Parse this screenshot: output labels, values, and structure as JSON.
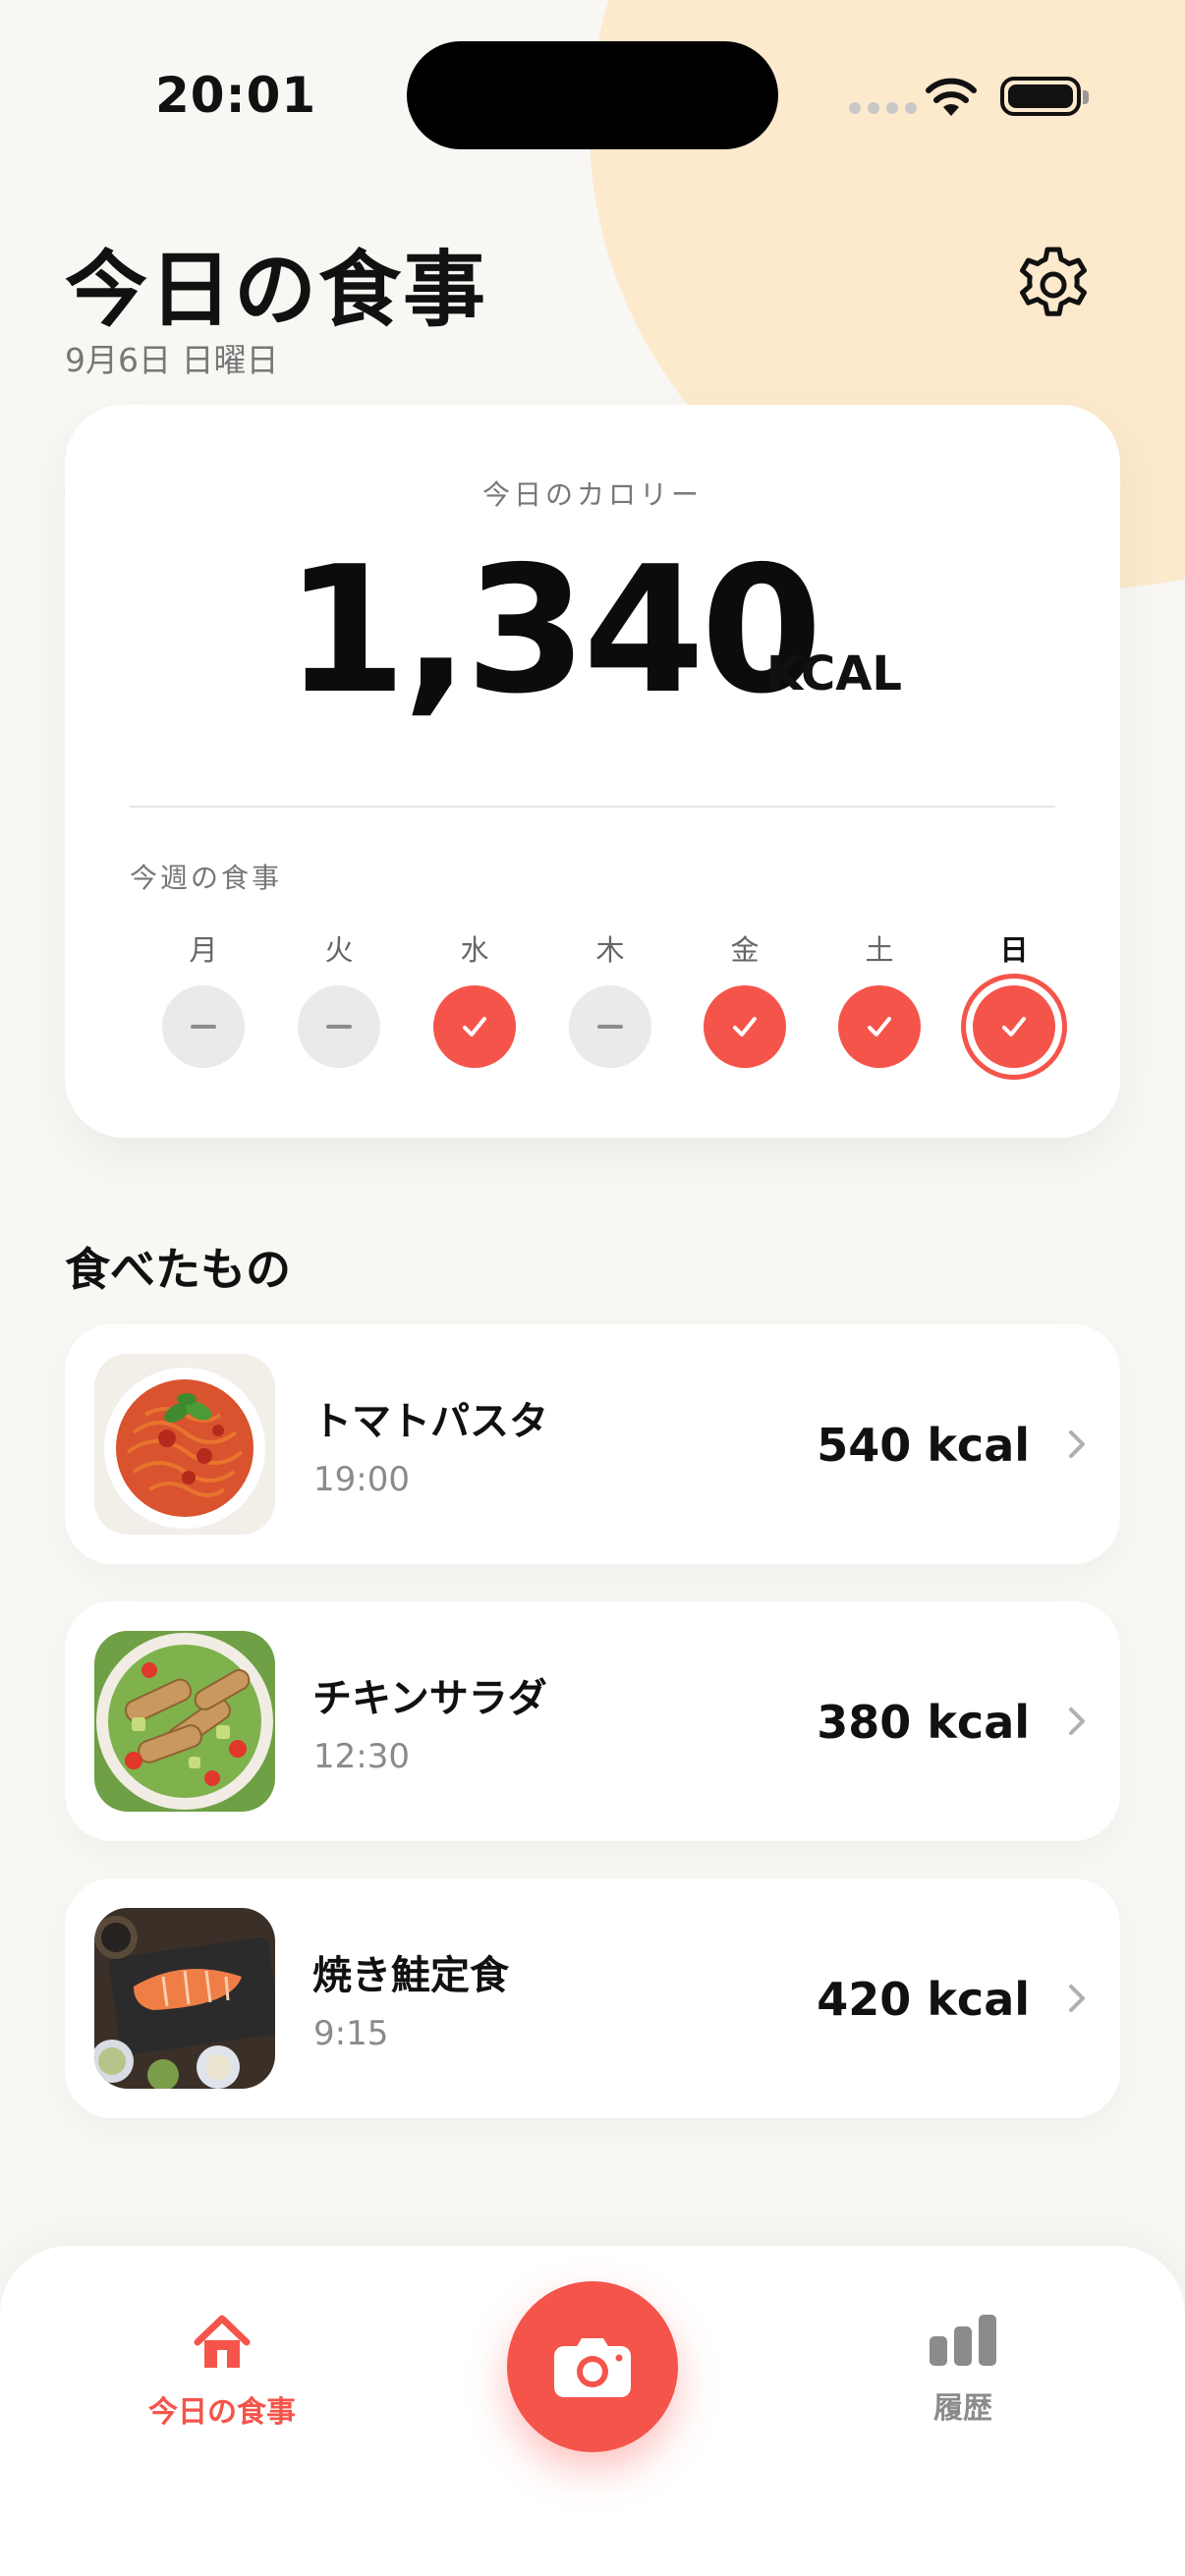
{
  "status_bar": {
    "time": "20:01"
  },
  "header": {
    "title": "今日の食事",
    "date": "9月6日 日曜日"
  },
  "calorie_card": {
    "label": "今日のカロリー",
    "value": "1,340",
    "unit": "KCAL",
    "week_label": "今週の食事",
    "days": [
      {
        "label": "月",
        "logged": false,
        "today": false
      },
      {
        "label": "火",
        "logged": false,
        "today": false
      },
      {
        "label": "水",
        "logged": true,
        "today": false
      },
      {
        "label": "木",
        "logged": false,
        "today": false
      },
      {
        "label": "金",
        "logged": true,
        "today": false
      },
      {
        "label": "土",
        "logged": true,
        "today": false
      },
      {
        "label": "日",
        "logged": true,
        "today": true
      }
    ]
  },
  "eaten_section": {
    "title": "食べたもの",
    "meals": [
      {
        "name": "トマトパスタ",
        "time": "19:00",
        "kcal": "540 kcal",
        "image": "tomato-pasta-photo"
      },
      {
        "name": "チキンサラダ",
        "time": "12:30",
        "kcal": "380 kcal",
        "image": "chicken-salad-photo"
      },
      {
        "name": "焼き鮭定食",
        "time": "9:15",
        "kcal": "420 kcal",
        "image": "grilled-salmon-set-photo"
      }
    ]
  },
  "tab_bar": {
    "home_label": "今日の食事",
    "history_label": "履歴",
    "camera_icon": "camera-icon"
  },
  "colors": {
    "accent": "#f5544b",
    "background": "#f8f7f4",
    "blob": "#fde9cc",
    "inactive": "#8b8b8b"
  }
}
